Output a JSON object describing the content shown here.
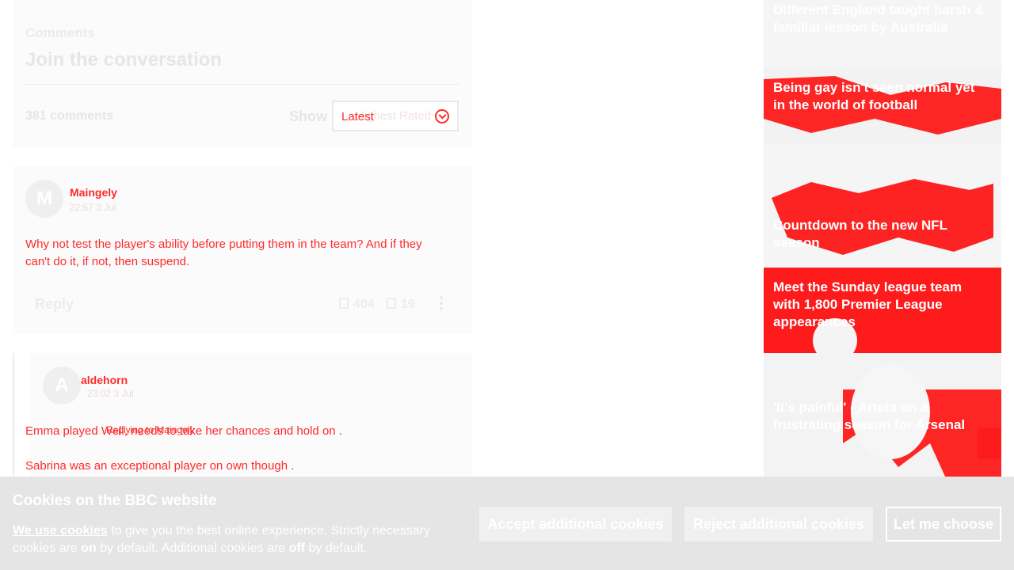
{
  "comments": {
    "kicker": "Comments",
    "title": "Join the conversation",
    "count": "381 comments",
    "show_label": "Show",
    "sort_selected": "Latest",
    "sort_option_behind": "Highest Rated"
  },
  "comment_1": {
    "avatar_initial": "M",
    "author": "Maingely",
    "time": "22:57 3 Jul",
    "body_line1": "Why not test the player's ability before putting them in the team? And if they",
    "body_line2": "can't do it, if not, then suspend.",
    "reply_label": "Reply",
    "likes": "404",
    "dislikes": "19"
  },
  "comment_2": {
    "avatar_initial": "A",
    "author": "aldehorn",
    "time": "23:02 3 Jul",
    "reply_to": "Replying to Maingely",
    "body_line1": "Emma played Well, needs to take her chances and hold on .",
    "body_line2": "Sabrina was an exceptional player on own though ."
  },
  "rail": {
    "promos": [
      {
        "title": "Different England taught harsh & familiar lesson by Australia"
      },
      {
        "title": "Being gay isn't seen normal yet in the world of football"
      },
      {
        "title": "Countdown to the new NFL season"
      },
      {
        "title": "Meet the Sunday league team with 1,800 Premier League appearances"
      },
      {
        "title": "'It's painful' - Arteta on a frustrating season for Arsenal"
      }
    ]
  },
  "cookie": {
    "title": "Cookies on the BBC website",
    "link": "We use cookies",
    "text_1": " to give you the best online experience. Strictly necessary cookies are ",
    "on": "on",
    "text_2": " by default. Additional cookies are ",
    "off": "off",
    "text_3": " by default.",
    "accept": "Accept additional cookies",
    "reject": "Reject additional cookies",
    "choose": "Let me choose"
  },
  "colors": {
    "accent_red": "#ff2a2a",
    "pale_grey": "#f0f0f0"
  }
}
